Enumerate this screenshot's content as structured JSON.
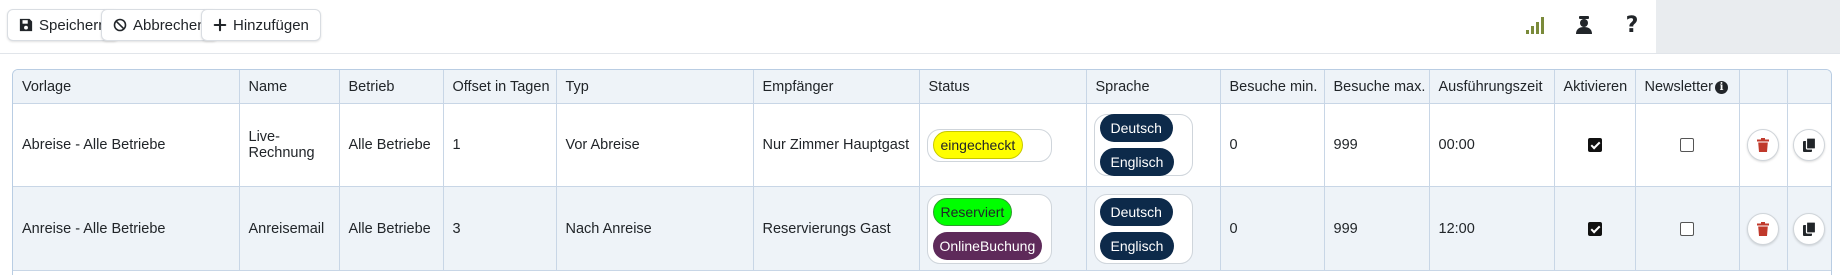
{
  "toolbar": {
    "save_label": "Speichern",
    "cancel_label": "Abbrechen",
    "add_label": "Hinzufügen",
    "icons": [
      "signal-icon",
      "user-icon",
      "help-icon"
    ],
    "signal_color": "#7a8a3a"
  },
  "table": {
    "headers": {
      "vorlage": "Vorlage",
      "name": "Name",
      "betrieb": "Betrieb",
      "offset": "Offset in Tagen",
      "typ": "Typ",
      "empfaenger": "Empfänger",
      "status": "Status",
      "sprache": "Sprache",
      "besuche_min": "Besuche min.",
      "besuche_max": "Besuche max.",
      "ausfuehrungszeit": "Ausführungszeit",
      "aktivieren": "Aktivieren",
      "newsletter": "Newsletter"
    },
    "rows": [
      {
        "vorlage": "Abreise - Alle Betriebe",
        "name": "Live-Rechnung",
        "betrieb": "Alle Betriebe",
        "offset": "1",
        "typ": "Vor Abreise",
        "empfaenger": "Nur Zimmer Hauptgast",
        "status": [
          "eingecheckt"
        ],
        "sprache": [
          "Deutsch",
          "Englisch"
        ],
        "besuche_min": "0",
        "besuche_max": "999",
        "ausfuehrungszeit": "00:00",
        "aktivieren": true,
        "newsletter": false
      },
      {
        "vorlage": "Anreise - Alle Betriebe",
        "name": "Anreisemail",
        "betrieb": "Alle Betriebe",
        "offset": "3",
        "typ": "Nach Anreise",
        "empfaenger": "Reservierungs Gast",
        "status": [
          "Reserviert",
          "OnlineBuchung"
        ],
        "sprache": [
          "Deutsch",
          "Englisch"
        ],
        "besuche_min": "0",
        "besuche_max": "999",
        "ausfuehrungszeit": "12:00",
        "aktivieren": true,
        "newsletter": false
      }
    ]
  },
  "colors": {
    "status_eingecheckt": "#ffff00",
    "status_reserviert": "#00ff00",
    "status_onlinebuchung": "#5e2a5a",
    "language_pill": "#0d2a4a",
    "delete_icon": "#c0392b",
    "header_bg": "#eef3f8"
  }
}
